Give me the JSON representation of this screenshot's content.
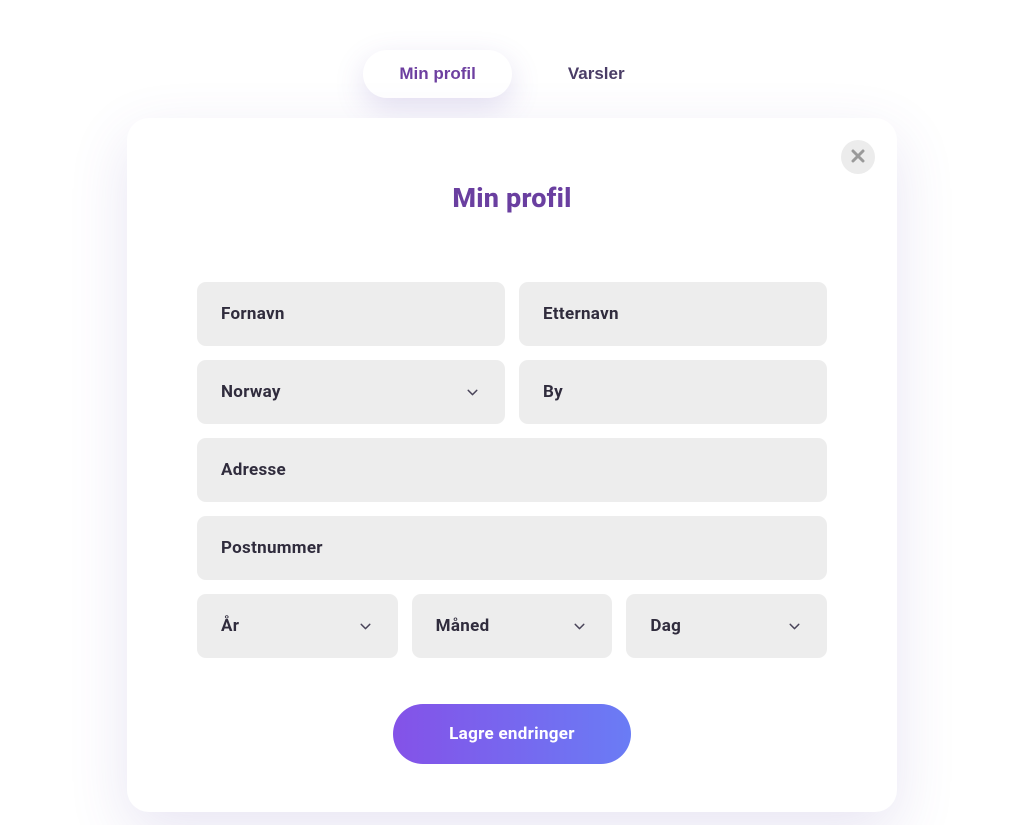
{
  "tabs": {
    "profile": "Min profil",
    "notifications": "Varsler"
  },
  "card": {
    "title": "Min profil"
  },
  "form": {
    "firstName": {
      "placeholder": "Fornavn",
      "value": ""
    },
    "lastName": {
      "placeholder": "Etternavn",
      "value": ""
    },
    "country": {
      "selected": "Norway"
    },
    "city": {
      "placeholder": "By",
      "value": ""
    },
    "address": {
      "placeholder": "Adresse",
      "value": ""
    },
    "postalCode": {
      "placeholder": "Postnummer",
      "value": ""
    },
    "year": {
      "label": "År"
    },
    "month": {
      "label": "Måned"
    },
    "day": {
      "label": "Dag"
    },
    "submit": "Lagre endringer"
  }
}
